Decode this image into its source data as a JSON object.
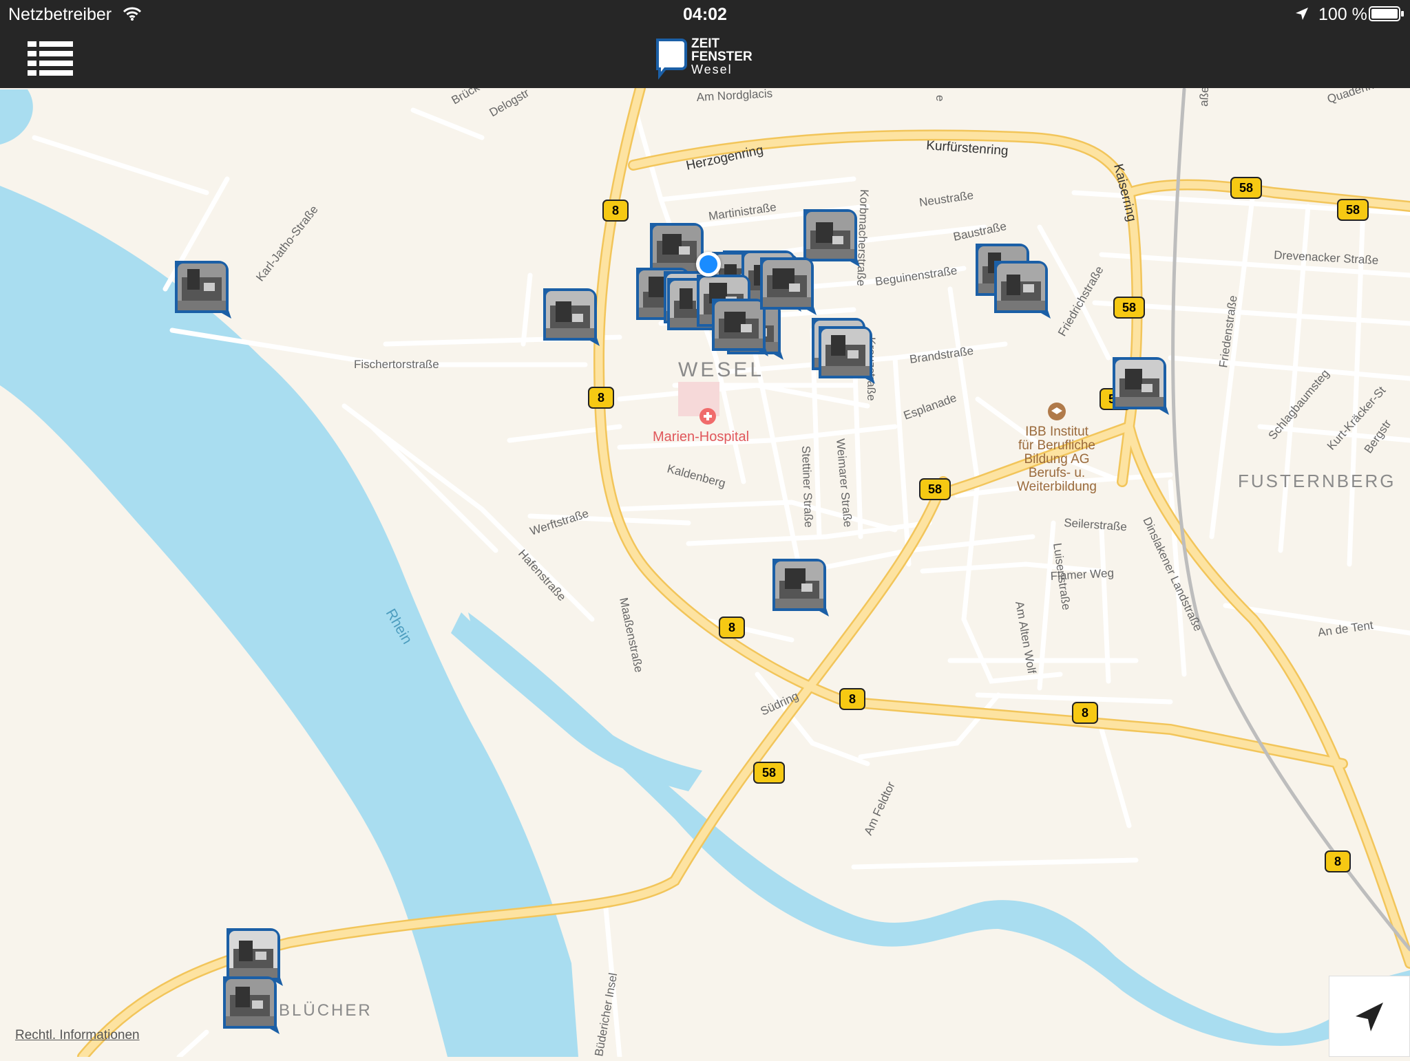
{
  "status_bar": {
    "carrier": "Netzbetreiber",
    "time": "04:02",
    "battery": "100 %"
  },
  "app": {
    "logo_line1": "ZEIT",
    "logo_line2": "FENSTER",
    "logo_line3": "Wesel"
  },
  "icons": {
    "menu": "list-menu-icon",
    "locate": "location-arrow-icon",
    "hospital": "hospital-cross-icon",
    "school": "education-cap-icon",
    "wifi": "wifi-icon",
    "battery": "battery-icon"
  },
  "colors": {
    "pin": "#1b5fa6",
    "water": "#a9ddf0",
    "major_road": "#fbd76e",
    "shield": "#f6c913",
    "user_location": "#1a8cff",
    "bar": "#262626"
  },
  "map": {
    "labels": {
      "city": "WESEL",
      "district1": "FUSTERNBERG",
      "district2": "BLÜCHER",
      "river": "Rhein",
      "hospital": "Marien-Hospital",
      "poi1": "IBB Institut",
      "poi2": "für Berufliche",
      "poi3": "Bildung AG",
      "poi4": "Berufs- u.",
      "poi5": "Weiterbildung",
      "s_herzogenring": "Herzogenring",
      "s_kurfuerstenring": "Kurfürstenring",
      "s_kaiserring": "Kaiserring",
      "s_am_nordglacis": "Am Nordglacis",
      "s_martinistrasse": "Martinistraße",
      "s_neustrasse": "Neustraße",
      "s_baustrasse": "Baustraße",
      "s_beguinenstrasse": "Beguinenstraße",
      "s_korbmacherstrasse": "Korbmacherstraße",
      "s_friedrichstrasse": "Friedrichstraße",
      "s_drevenacker": "Drevenacker Straße",
      "s_karl_jatho": "Karl-Jatho-Straße",
      "s_fischertor": "Fischertorstraße",
      "s_brandstrasse": "Brandstraße",
      "s_esplanade": "Esplanade",
      "s_kreuzstrasse": "Kreuzstraße",
      "s_kaldenberg": "Kaldenberg",
      "s_stettiner": "Stettiner Straße",
      "s_weimarer": "Weimarer Straße",
      "s_werftstrasse": "Werftstraße",
      "s_hafenstrasse": "Hafenstraße",
      "s_massenstrasse": "Maaßenstraße",
      "s_suedring": "Südring",
      "s_seilerstrasse": "Seilerstraße",
      "s_flamer_weg": "Flamer Weg",
      "s_luisenstrasse": "Luisenstraße",
      "s_am_alten_wolf": "Am Alten Wolf",
      "s_dinslakener": "Dinslakener Landstraße",
      "s_friedenstrasse": "Friedenstraße",
      "s_schlagbaumsteg": "Schlagbaumsteg",
      "s_kurt_kraecker": "Kurt-Kräcker-St",
      "s_bergstr": "Bergstr",
      "s_an_de_tent": "An de Tent",
      "s_am_feldtor": "Am Feldtor",
      "s_buedericher_insel": "Büdericher Insel",
      "s_delogstr": "Delogstr",
      "s_brueck": "Brück",
      "s_quadenring": "Quadenri",
      "s_top1": "e",
      "s_top2": "aße",
      "s_top3": "aße"
    },
    "shields": [
      "8",
      "8",
      "8",
      "8",
      "8",
      "8",
      "58",
      "58",
      "58",
      "58",
      "58",
      "58"
    ],
    "pins": [
      "photo-pin-1",
      "photo-pin-2",
      "photo-pin-3",
      "photo-pin-4",
      "photo-pin-5",
      "photo-pin-6",
      "photo-pin-7",
      "photo-pin-8",
      "photo-pin-9",
      "photo-pin-10",
      "photo-pin-11",
      "photo-pin-12",
      "photo-pin-13",
      "photo-pin-14",
      "photo-pin-15",
      "photo-pin-16",
      "photo-pin-17",
      "photo-pin-18",
      "photo-pin-19",
      "photo-pin-20",
      "photo-pin-21",
      "photo-pin-22",
      "photo-pin-23",
      "photo-pin-24"
    ]
  },
  "footer": {
    "legal_link": "Rechtl. Informationen"
  }
}
